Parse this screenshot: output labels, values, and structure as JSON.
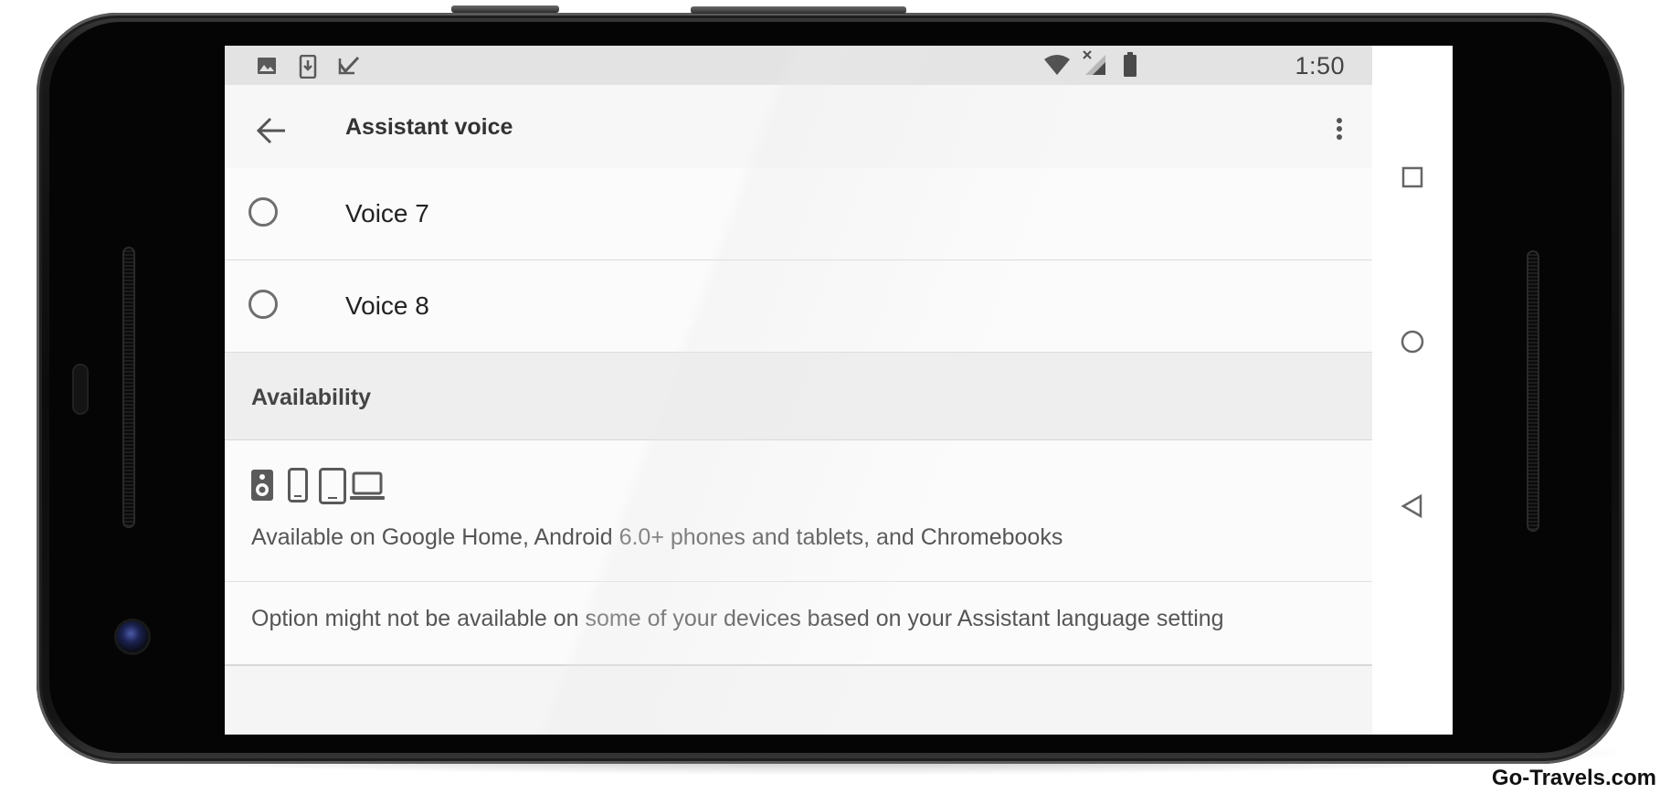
{
  "status_bar": {
    "time": "1:50",
    "left_icons": [
      "image-icon",
      "download-icon",
      "task-done-icon"
    ],
    "right_icons": [
      "wifi-icon",
      "no-signal-icon",
      "battery-icon"
    ]
  },
  "toolbar": {
    "title": "Assistant voice",
    "back_icon": "arrow-left-icon",
    "menu_icon": "more-vert-icon"
  },
  "voices": [
    {
      "label": "Voice 7",
      "selected": false
    },
    {
      "label": "Voice 8",
      "selected": false
    }
  ],
  "availability": {
    "header": "Availability",
    "device_icons": [
      "speaker-icon",
      "phone-icon",
      "tablet-icon",
      "laptop-icon"
    ],
    "description": "Available on Google Home, Android 6.0+ phones and tablets, and Chromebooks",
    "note": "Option might not be available on some of your devices based on your Assistant language setting"
  },
  "nav_bar": {
    "buttons": [
      "recents-square-icon",
      "home-circle-icon",
      "back-triangle-icon"
    ]
  },
  "watermark": "Go-Travels.com",
  "colors": {
    "status_bar": "#e3e3e3",
    "toolbar": "#f7f7f7",
    "section_header": "#eeeeee",
    "phone_body": "#0c0c0c"
  }
}
